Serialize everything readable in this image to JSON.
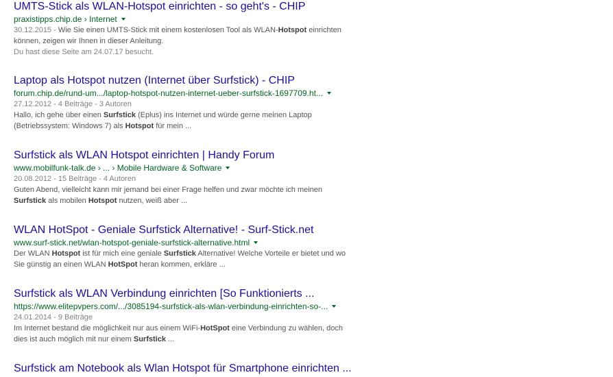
{
  "results": [
    {
      "title": "UMTS-Stick als WLAN-Hotspot einrichten - so geht's - CHIP",
      "url": "praxistipps.chip.de › Internet",
      "meta": "30.12.2015 - ",
      "snippet_lines": [
        [
          {
            "t": "Wie Sie einen UMTS-Stick mit einem kostenlosen Tool als WLAN-",
            "b": false
          },
          {
            "t": "Hotspot",
            "b": true
          },
          {
            "t": " einrichten",
            "b": false
          }
        ],
        [
          {
            "t": "können, zeigen wir Ihnen in dieser Anleitung.",
            "b": false
          }
        ]
      ],
      "visited": "Du hast diese Seite am 24.07.17 besucht."
    },
    {
      "title": "Laptop als Hotspot nutzen (Internet über Surfstick) - CHIP",
      "url": "forum.chip.de/rund-um.../laptop-hotspot-nutzen-internet-ueber-surfstick-1697709.ht...",
      "meta": "27.12.2012 - 4 Beiträge - 3 Autoren",
      "snippet_lines": [
        [
          {
            "t": "Hallo, ich gehe über einen ",
            "b": false
          },
          {
            "t": "Surfstick",
            "b": true
          },
          {
            "t": " (Eplus) ins Internet und würde gerne meinen Laptop",
            "b": false
          }
        ],
        [
          {
            "t": "(Betriebssystem: Windows 7) als ",
            "b": false
          },
          {
            "t": "Hotspot",
            "b": true
          },
          {
            "t": " für mein ...",
            "b": false
          }
        ]
      ],
      "visited": ""
    },
    {
      "title": "Surfstick als WLAN Hotspot einrichten | Handy Forum",
      "url": "www.mobilfunk-talk.de › ... › Mobile Hardware & Software",
      "meta": "20.08.2012 - 15 Beiträge - 4 Autoren",
      "snippet_lines": [
        [
          {
            "t": "Guten Abend, vielleicht kann mir jemand bei einer Frage helfen und zwar möchte ich meinen",
            "b": false
          }
        ],
        [
          {
            "t": "Surfstick",
            "b": true
          },
          {
            "t": " als mobilen ",
            "b": false
          },
          {
            "t": "Hotspot",
            "b": true
          },
          {
            "t": " nutzen, weiß aber ...",
            "b": false
          }
        ]
      ],
      "visited": ""
    },
    {
      "title": "WLAN HotSpot - Geniale Surfstick Alternative! - Surf-Stick.net",
      "url": "www.surf-stick.net/wlan-hotspot-geniale-surfstick-alternative.html",
      "meta": "",
      "snippet_lines": [
        [
          {
            "t": "Der WLAN ",
            "b": false
          },
          {
            "t": "Hotspot",
            "b": true
          },
          {
            "t": " ist für mich eine geniale ",
            "b": false
          },
          {
            "t": "Surfstick",
            "b": true
          },
          {
            "t": " Alternative! Welche Vorteile er bietet und wo",
            "b": false
          }
        ],
        [
          {
            "t": "Sie günstig an einen WLAN ",
            "b": false
          },
          {
            "t": "HotSpot",
            "b": true
          },
          {
            "t": " heran kommen, erkläre ...",
            "b": false
          }
        ]
      ],
      "visited": ""
    },
    {
      "title": "Surfstick als WLAN Verbindung einrichten [So Funktionierts ...",
      "url": "https://www.elitepvpers.com/.../3085194-surfstick-als-wlan-verbindung-einrichten-so-...",
      "meta": "24.01.2014 - 9 Beiträge",
      "snippet_lines": [
        [
          {
            "t": "Im Internet bestand die möglichkeit nur aus einem WiFi-",
            "b": false
          },
          {
            "t": "HotSpot",
            "b": true
          },
          {
            "t": " eine Verbindung zu wählen, doch",
            "b": false
          }
        ],
        [
          {
            "t": "dies ist auch möglich mit nur einem ",
            "b": false
          },
          {
            "t": "Surfstick",
            "b": true
          },
          {
            "t": " ...",
            "b": false
          }
        ]
      ],
      "visited": ""
    },
    {
      "title": "Surfstick am Notebook als Wlan Hotspot für Smartphone einrichten ...",
      "url": "",
      "meta": "",
      "snippet_lines": [],
      "visited": ""
    }
  ]
}
